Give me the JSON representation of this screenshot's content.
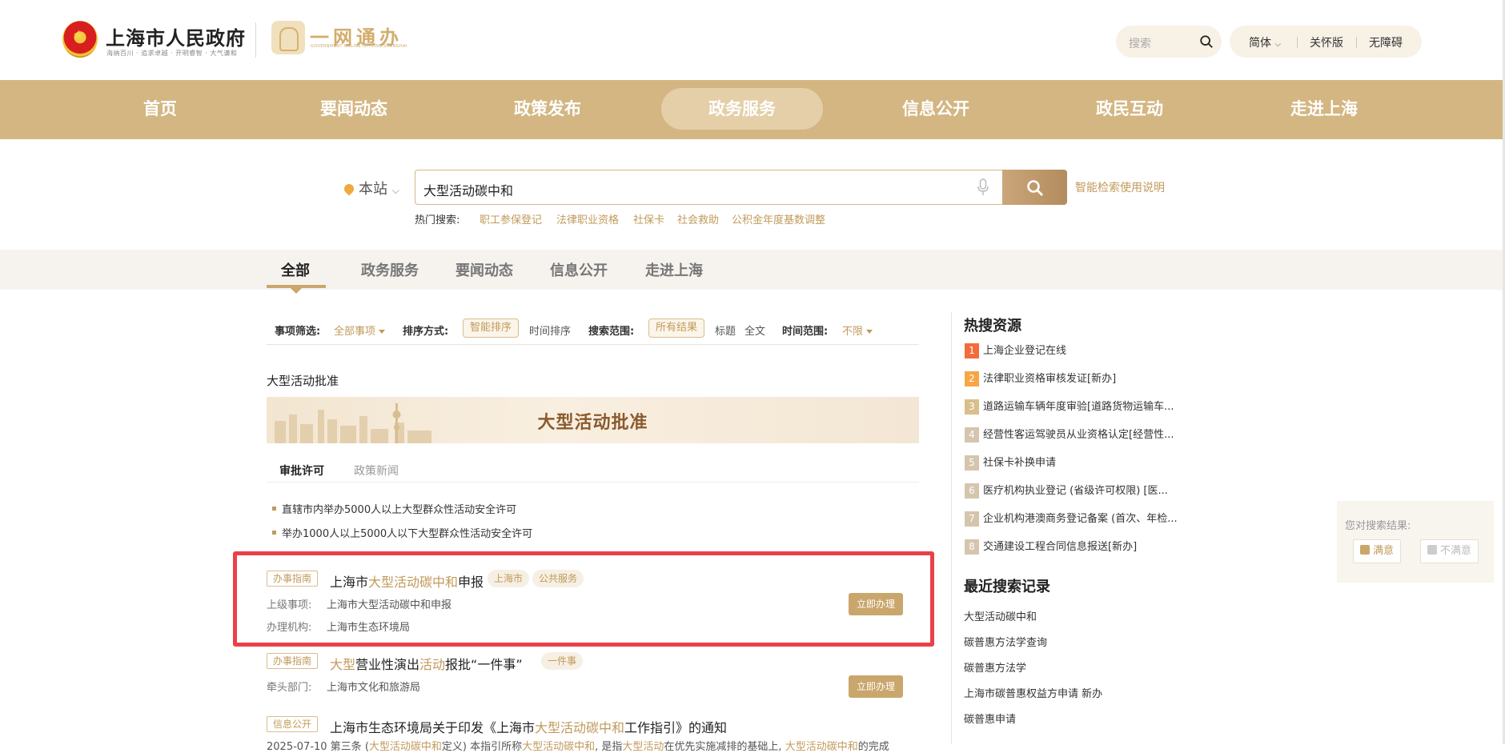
{
  "header": {
    "site_title": "上海市人民政府",
    "site_slogan": "海纳百川 · 追求卓越 · 开明睿智 · 大气谦和",
    "ywtb_title": "一网通办",
    "ywtb_sub": "GOVERNMENT ONLINE-OFFLINE SHANGHAI",
    "search_placeholder": "搜索",
    "lang_label": "简体",
    "elder_label": "关怀版",
    "accessible_label": "无障碍"
  },
  "nav": {
    "items": [
      "首页",
      "要闻动态",
      "政策发布",
      "政务服务",
      "信息公开",
      "政民互动",
      "走进上海"
    ],
    "active": "政务服务"
  },
  "search": {
    "scope_label": "本站",
    "query": "大型活动碳中和",
    "help_link": "智能检索使用说明",
    "hot_label": "热门搜索:",
    "hot_items": [
      "职工参保登记",
      "法律职业资格",
      "社保卡",
      "社会救助",
      "公积金年度基数调整"
    ]
  },
  "category_tabs": [
    "全部",
    "政务服务",
    "要闻动态",
    "信息公开",
    "走进上海"
  ],
  "filters": {
    "item_filter_label": "事项筛选:",
    "item_filter_value": "全部事项",
    "sort_label": "排序方式:",
    "sort_smart": "智能排序",
    "sort_time": "时间排序",
    "scope_label": "搜索范围:",
    "scope_all": "所有结果",
    "scope_title": "标题",
    "scope_fulltext": "全文",
    "time_label": "时间范围:",
    "time_value": "不限"
  },
  "featured": {
    "title": "大型活动批准",
    "banner_text": "大型活动批准",
    "tabs": [
      "审批许可",
      "政策新闻"
    ],
    "bullets": [
      "直辖市内举办5000人以上大型群众性活动安全许可",
      "举办1000人以上5000人以下大型群众性活动安全许可"
    ]
  },
  "results": [
    {
      "tag": "办事指南",
      "title_parts": [
        "上海市",
        "大型活动碳中和",
        "申报"
      ],
      "pills": [
        "上海市",
        "公共服务"
      ],
      "meta": [
        [
          "上级事项:",
          "上海市大型活动碳中和申报"
        ],
        [
          "办理机构:",
          "上海市生态环境局"
        ]
      ],
      "button": "立即办理"
    },
    {
      "tag": "办事指南",
      "title_parts": [
        "大型",
        "营业性演出",
        "活动",
        "报批“一件事”"
      ],
      "pills": [
        "一件事"
      ],
      "meta": [
        [
          "牵头部门:",
          "上海市文化和旅游局"
        ]
      ],
      "button": "立即办理"
    },
    {
      "tag": "信息公开",
      "title_parts": [
        "上海市生态环境局关于印发《上海市",
        "大型活动碳中和",
        "工作指引》的通知"
      ],
      "snippet_parts": [
        "2025-07-10    第三条 (",
        "大型活动碳中和",
        "定义) 本指引所称",
        "大型活动碳中和",
        ", 是指",
        "大型活动",
        "在优先实施减排的基础上, ",
        "大型活动碳中和",
        "的完成"
      ]
    }
  ],
  "sidebar": {
    "hot_title": "热搜资源",
    "hot_list": [
      "上海企业登记在线",
      "法律职业资格审核发证[新办]",
      "道路运输车辆年度审验[道路货物运输车...",
      "经营性客运驾驶员从业资格认定[经营性...",
      "社保卡补换申请",
      "医疗机构执业登记 (省级许可权限) [医...",
      "企业机构港澳商务登记备案 (首次、年检...",
      "交通建设工程合同信息报送[新办]"
    ],
    "recent_title": "最近搜索记录",
    "recent_list": [
      "大型活动碳中和",
      "碳普惠方法学查询",
      "碳普惠方法学",
      "上海市碳普惠权益方申请 新办",
      "碳普惠申请"
    ]
  },
  "feedback": {
    "question": "您对搜索结果:",
    "satisfied": "满意",
    "unsatisfied": "不满意"
  },
  "colors": {
    "brand_gold": "#d3b682",
    "accent_text": "#c19a5b",
    "highlight_border": "#ea4148"
  }
}
